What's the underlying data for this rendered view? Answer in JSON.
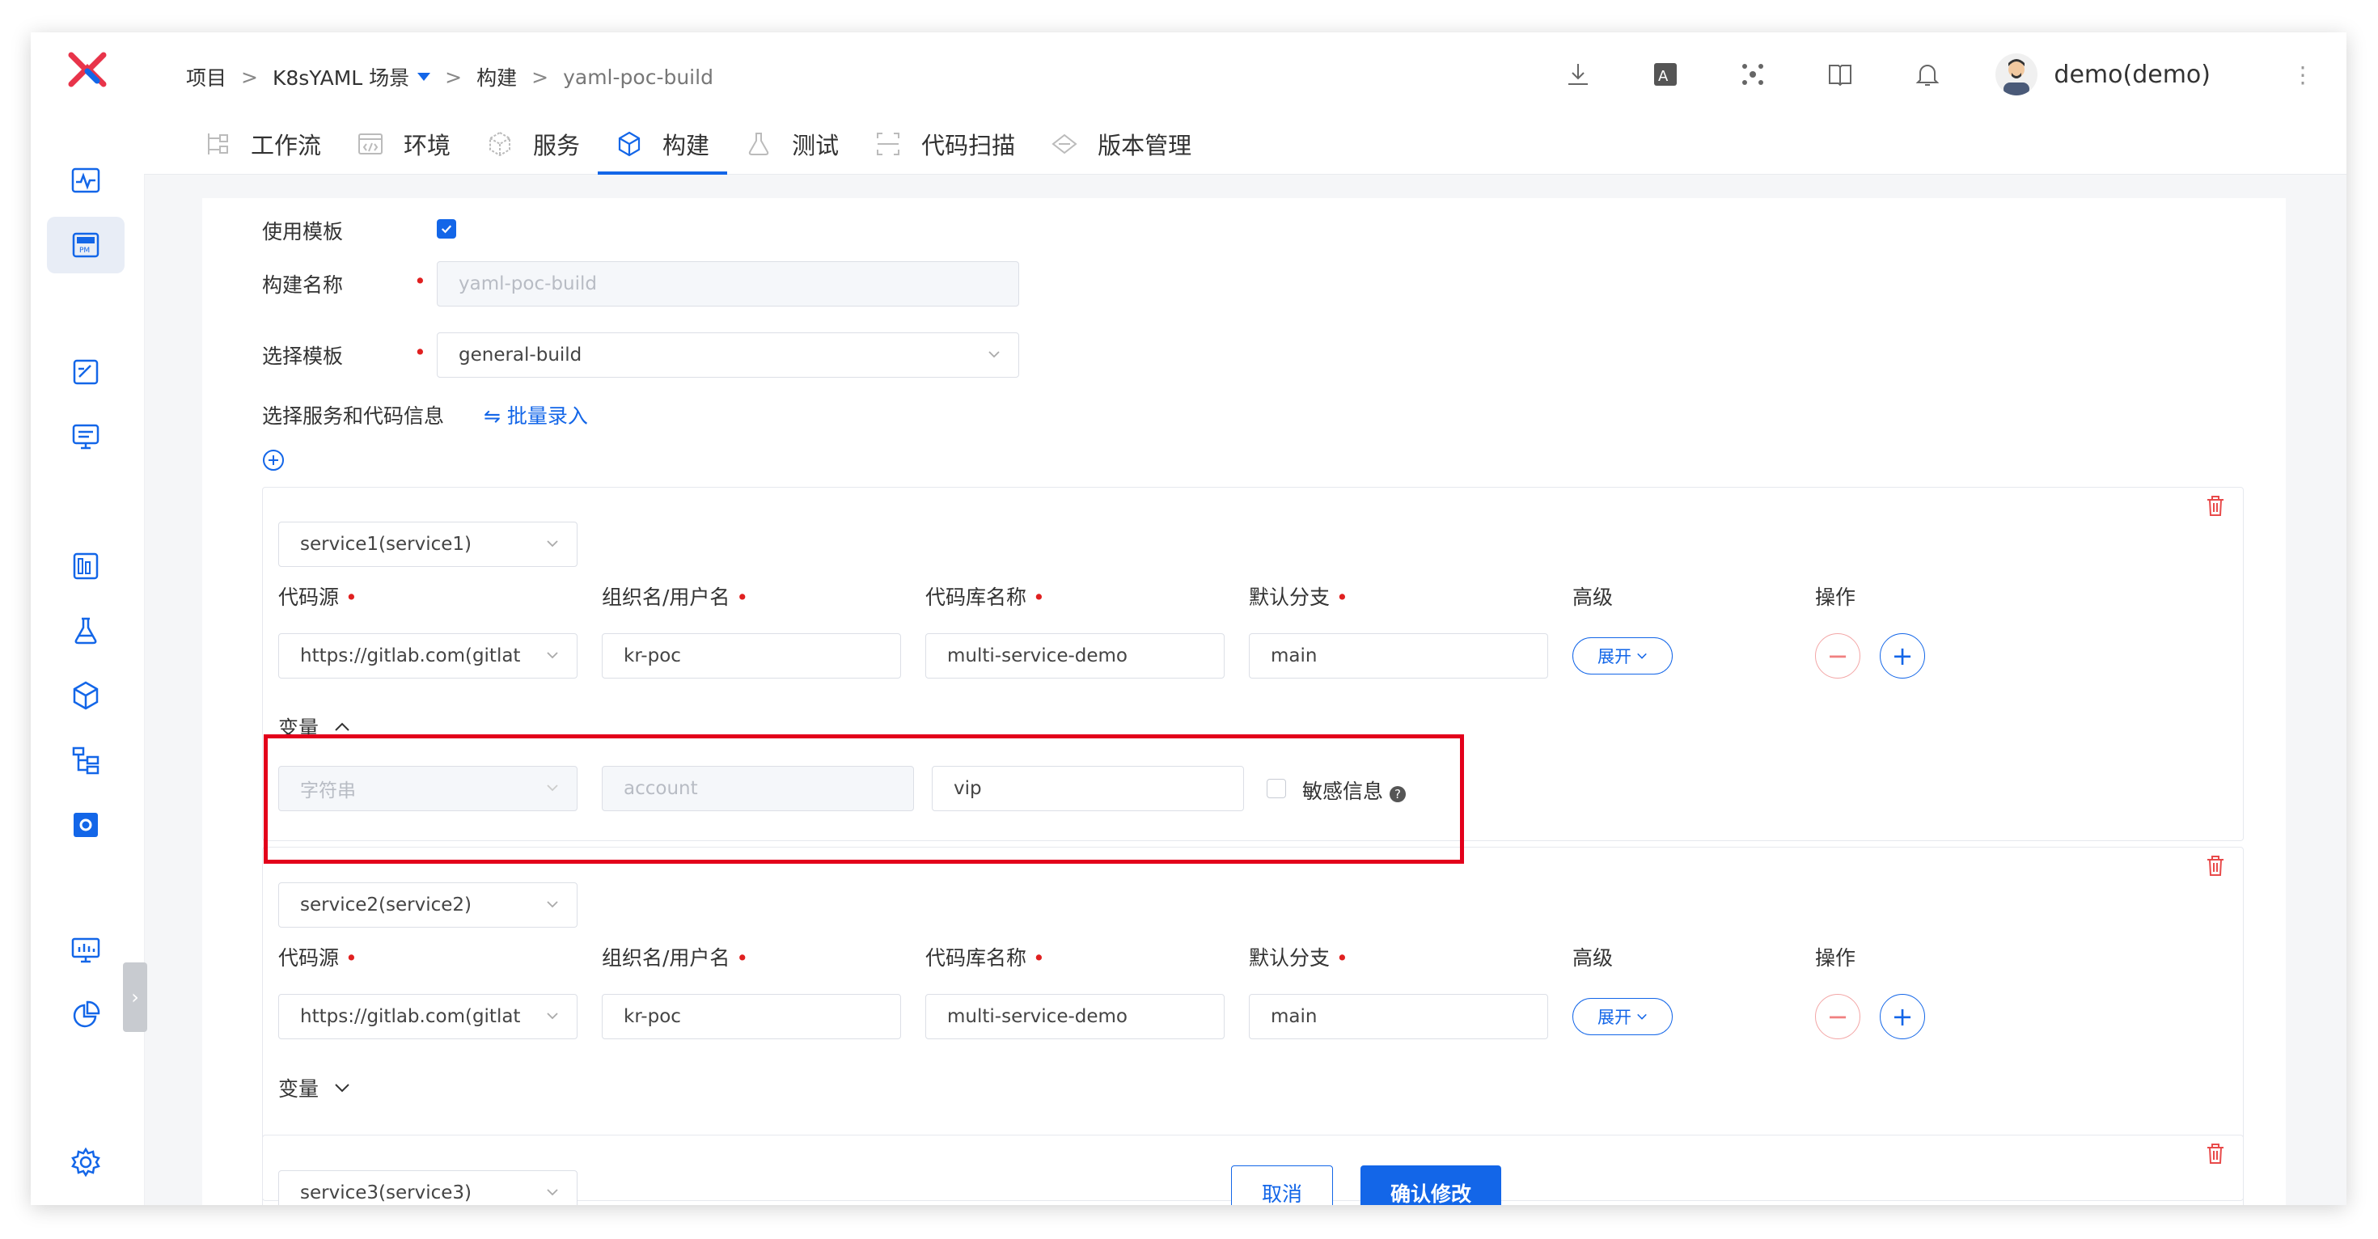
{
  "breadcrumb": {
    "project": "项目",
    "scene": "K8sYAML 场景",
    "section": "构建",
    "current": "yaml-poc-build"
  },
  "user": {
    "name": "demo(demo)"
  },
  "tabs": [
    {
      "label": "工作流",
      "icon": "workflow-icon"
    },
    {
      "label": "环境",
      "icon": "environment-icon"
    },
    {
      "label": "服务",
      "icon": "service-icon"
    },
    {
      "label": "构建",
      "icon": "build-icon",
      "active": true
    },
    {
      "label": "测试",
      "icon": "test-flask-icon"
    },
    {
      "label": "代码扫描",
      "icon": "code-scan-icon"
    },
    {
      "label": "版本管理",
      "icon": "version-diamond-icon"
    }
  ],
  "form": {
    "use_template_label": "使用模板",
    "use_template_checked": true,
    "build_name_label": "构建名称",
    "build_name_placeholder": "yaml-poc-build",
    "template_label": "选择模板",
    "template_value": "general-build",
    "select_services_label": "选择服务和代码信息",
    "batch_input_link": "批量录入"
  },
  "columns": {
    "code_source": "代码源",
    "org_user": "组织名/用户名",
    "repo_name": "代码库名称",
    "default_branch": "默认分支",
    "advanced": "高级",
    "actions": "操作"
  },
  "services": [
    {
      "service": "service1(service1)",
      "code_source": "https://gitlab.com(gitlat",
      "org": "kr-poc",
      "repo": "multi-service-demo",
      "branch": "main",
      "expand_label": "展开",
      "vars_label": "变量",
      "vars_expanded": true,
      "var": {
        "type": "字符串",
        "key": "account",
        "value": "vip",
        "sensitive_label": "敏感信息"
      }
    },
    {
      "service": "service2(service2)",
      "code_source": "https://gitlab.com(gitlat",
      "org": "kr-poc",
      "repo": "multi-service-demo",
      "branch": "main",
      "expand_label": "展开",
      "vars_label": "变量",
      "vars_expanded": false
    },
    {
      "service": "service3(service3)"
    }
  ],
  "buttons": {
    "cancel": "取消",
    "confirm": "确认修改"
  },
  "colors": {
    "primary": "#1366e8",
    "danger": "#e3001b",
    "logo": "#e8344a"
  }
}
